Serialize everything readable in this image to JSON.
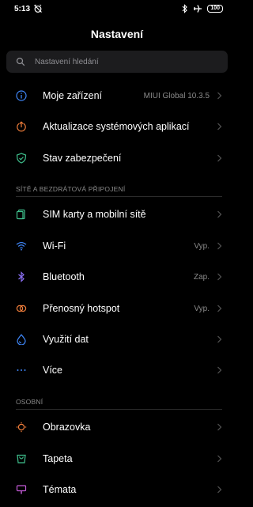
{
  "status_bar": {
    "time": "5:13",
    "battery": "100"
  },
  "page": {
    "title": "Nastavení"
  },
  "search": {
    "placeholder": "Nastavení hledání"
  },
  "items": [
    {
      "label": "Moje zařízení",
      "value": "MIUI Global 10.3.5",
      "icon": "info-icon",
      "color": "#3f86f7"
    },
    {
      "label": "Aktualizace systémových aplikací",
      "value": "",
      "icon": "update-icon",
      "color": "#f07d3a"
    },
    {
      "label": "Stav zabezpečení",
      "value": "",
      "icon": "shield-icon",
      "color": "#3fc08d"
    }
  ],
  "section_network": {
    "title": "SÍTĚ A BEZDRÁTOVÁ PŘIPOJENÍ"
  },
  "network_items": [
    {
      "label": "SIM karty a mobilní sítě",
      "value": "",
      "icon": "sim-icon",
      "color": "#3fc08d"
    },
    {
      "label": "Wi-Fi",
      "value": "Vyp.",
      "icon": "wifi-icon",
      "color": "#3f86f7"
    },
    {
      "label": "Bluetooth",
      "value": "Zap.",
      "icon": "bluetooth-icon",
      "color": "#8a6ef2"
    },
    {
      "label": "Přenosný hotspot",
      "value": "Vyp.",
      "icon": "hotspot-icon",
      "color": "#f07d3a"
    },
    {
      "label": "Využití dat",
      "value": "",
      "icon": "data-usage-icon",
      "color": "#3f86f7"
    },
    {
      "label": "Více",
      "value": "",
      "icon": "more-dots-icon",
      "color": "#3f86f7"
    }
  ],
  "section_personal": {
    "title": "OSOBNÍ"
  },
  "personal_items": [
    {
      "label": "Obrazovka",
      "value": "",
      "icon": "display-icon",
      "color": "#f07d3a"
    },
    {
      "label": "Tapeta",
      "value": "",
      "icon": "wallpaper-icon",
      "color": "#3fc08d"
    },
    {
      "label": "Témata",
      "value": "",
      "icon": "themes-icon",
      "color": "#c35ad6"
    }
  ]
}
